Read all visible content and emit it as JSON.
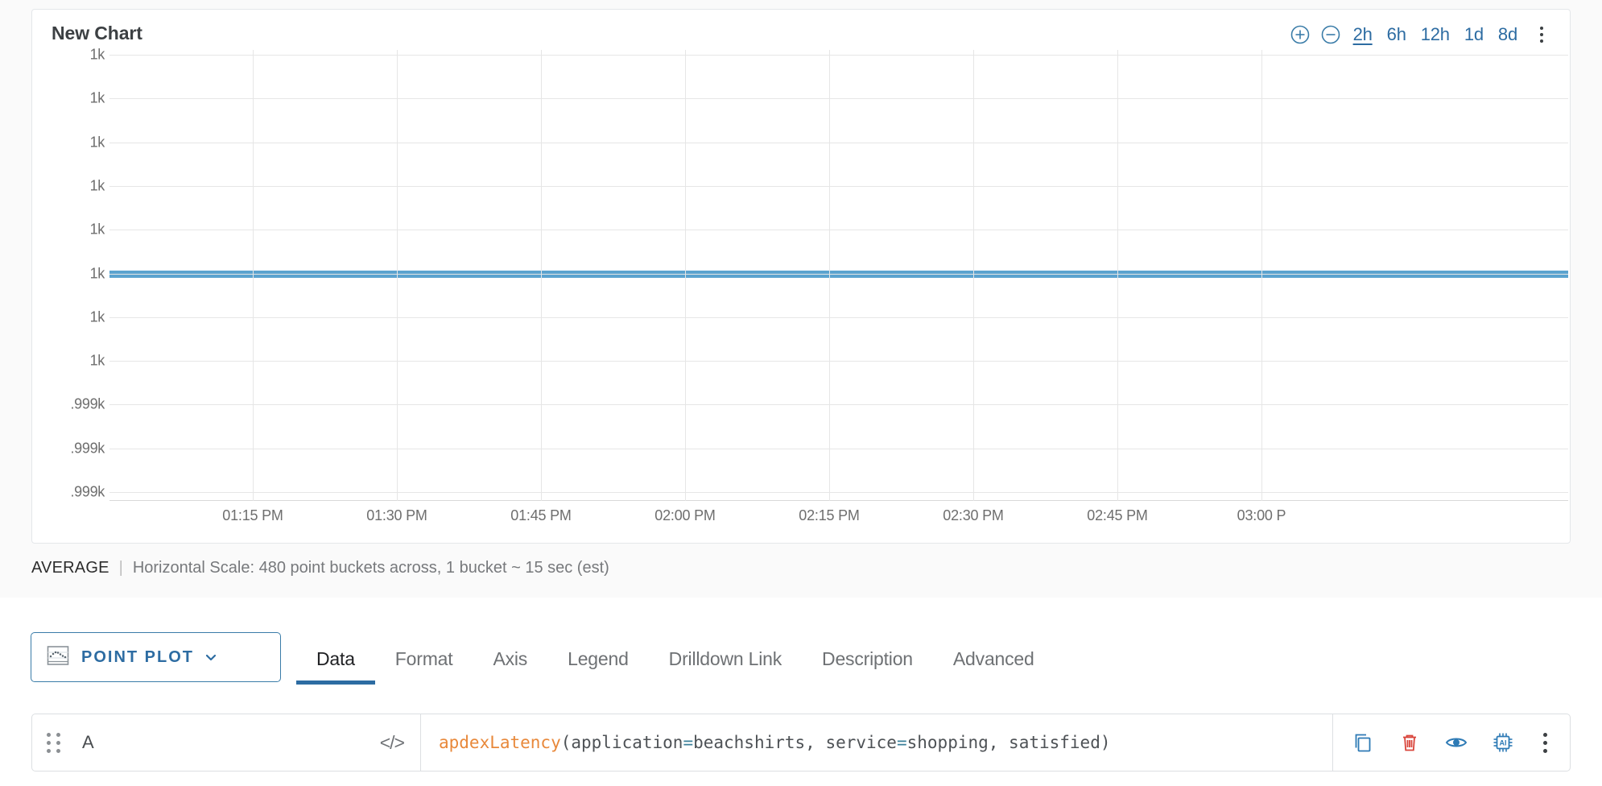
{
  "chart": {
    "title": "New Chart",
    "toolbar": {
      "zoom_in_icon": "plus-circle-icon",
      "zoom_out_icon": "minus-circle-icon",
      "ranges": [
        {
          "label": "2h",
          "active": true
        },
        {
          "label": "6h",
          "active": false
        },
        {
          "label": "12h",
          "active": false
        },
        {
          "label": "1d",
          "active": false
        },
        {
          "label": "8d",
          "active": false
        }
      ],
      "menu_icon": "kebab-menu-icon"
    },
    "footer": {
      "aggregation": "AVERAGE",
      "separator": "|",
      "scale": "Horizontal Scale: 480 point buckets across, 1 bucket ~ 15 sec (est)"
    }
  },
  "chart_data": {
    "type": "line",
    "title": "New Chart",
    "xlabel": "",
    "ylabel": "",
    "grid": true,
    "legend": "none",
    "series": [
      {
        "name": "apdexLatency(application=beachshirts, service=shopping, satisfied)",
        "color": "#5ba3cf",
        "constant_value": 1000,
        "values": [
          1000,
          1000,
          1000,
          1000,
          1000,
          1000,
          1000,
          1000
        ]
      }
    ],
    "x_tick_labels": [
      "01:15 PM",
      "01:30 PM",
      "01:45 PM",
      "02:00 PM",
      "02:15 PM",
      "02:30 PM",
      "02:45 PM",
      "03:00 P"
    ],
    "y_tick_labels": [
      "1k",
      "1k",
      "1k",
      "1k",
      "1k",
      "1k",
      "1k",
      "1k",
      ".999k",
      ".999k",
      ".999k"
    ],
    "y_value_at_series": "1k",
    "series_tick_index": 5,
    "ylim_labels": [
      "1k",
      ".999k"
    ],
    "aggregation": "AVERAGE",
    "bucket_note": "480 point buckets across, 1 bucket ~ 15 sec (est)"
  },
  "editor": {
    "plot_type": {
      "label": "POINT PLOT",
      "icon": "point-plot-icon",
      "chevron": "chevron-down-icon"
    },
    "tabs": [
      {
        "label": "Data",
        "active": true
      },
      {
        "label": "Format",
        "active": false
      },
      {
        "label": "Axis",
        "active": false
      },
      {
        "label": "Legend",
        "active": false
      },
      {
        "label": "Drilldown Link",
        "active": false
      },
      {
        "label": "Description",
        "active": false
      },
      {
        "label": "Advanced",
        "active": false
      }
    ]
  },
  "query": {
    "drag_handle_icon": "drag-handle-icon",
    "name": "A",
    "code_toggle_icon": "code-brackets-icon",
    "expression_full": "apdexLatency(application=beachshirts, service=shopping, satisfied)",
    "tokens": {
      "fn": "apdexLatency",
      "open": "(application",
      "eq1": "=",
      "mid": "beachshirts, service",
      "eq2": "=",
      "tail": "shopping, satisfied)"
    },
    "actions": [
      {
        "name": "clone-query",
        "icon": "copy-icon",
        "color": "#2d7ab5"
      },
      {
        "name": "delete-query",
        "icon": "trash-icon",
        "color": "#d9453b"
      },
      {
        "name": "toggle-visibility",
        "icon": "eye-icon",
        "color": "#2d7ab5"
      },
      {
        "name": "ai-assist",
        "icon": "ai-chip-icon",
        "color": "#2d7ab5"
      },
      {
        "name": "query-more-menu",
        "icon": "kebab-menu-icon",
        "color": "#3c4043"
      }
    ]
  },
  "colors": {
    "accent": "#2d6ca2",
    "series": "#5ba3cf",
    "danger": "#d9453b",
    "grid": "#e6e6e6"
  }
}
